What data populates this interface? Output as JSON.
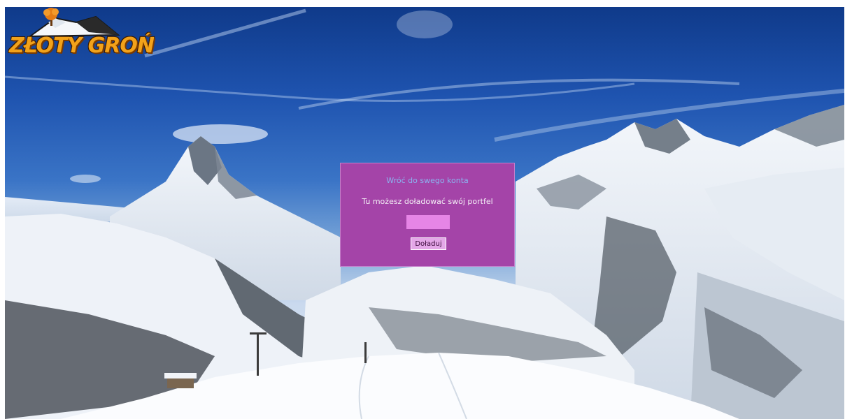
{
  "branding": {
    "logo_text": "ZŁOTY GROŃ"
  },
  "wallet_panel": {
    "title": "Wróć do swego konta",
    "subtitle": "Tu możesz doładować swój portfel",
    "amount_input_value": "",
    "topup_button_label": "Doładuj"
  },
  "colors": {
    "panel_background": "#a444a8",
    "panel_title": "#8ab4f0",
    "input_background": "#e685e6",
    "button_background": "#e4a7e8",
    "logo_text": "#f2a21a"
  },
  "icons": {
    "logo": "mountain-tree-logo-icon"
  }
}
